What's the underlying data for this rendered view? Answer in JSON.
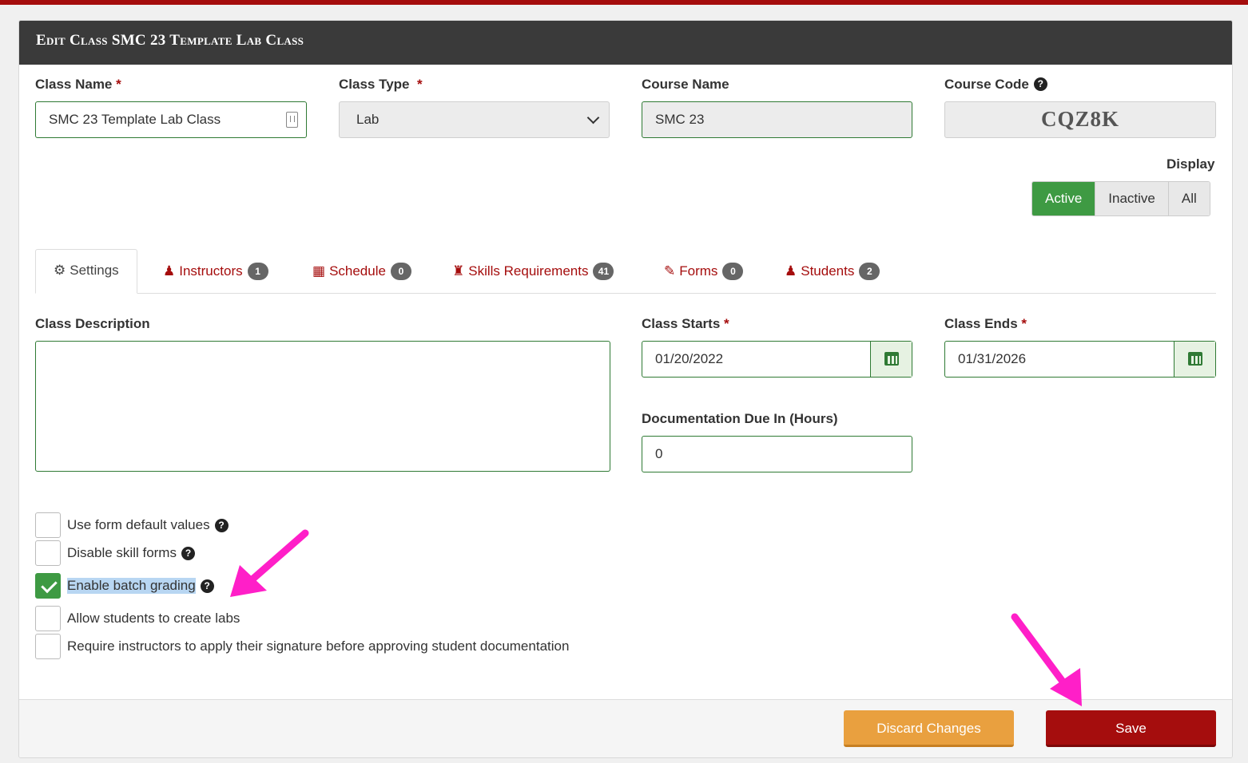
{
  "header": {
    "title": "Edit Class SMC 23 Template Lab Class"
  },
  "fields": {
    "class_name": {
      "label": "Class Name",
      "required": "*",
      "value": "SMC 23 Template Lab Class"
    },
    "class_type": {
      "label": "Class Type",
      "required": "*",
      "value": "Lab"
    },
    "course_name": {
      "label": "Course Name",
      "value": "SMC 23"
    },
    "course_code": {
      "label": "Course Code",
      "value": "CQZ8K"
    }
  },
  "display": {
    "label": "Display",
    "options": [
      "Active",
      "Inactive",
      "All"
    ],
    "selected": "Active",
    "accent_color": "#3e9a43"
  },
  "tabs": [
    {
      "label": "Settings",
      "icon": "gear-icon",
      "active": true
    },
    {
      "label": "Instructors",
      "icon": "user-icon",
      "count": "1"
    },
    {
      "label": "Schedule",
      "icon": "calendar-icon",
      "count": "0"
    },
    {
      "label": "Skills Requirements",
      "icon": "chess-rook-icon",
      "count": "41"
    },
    {
      "label": "Forms",
      "icon": "pencil-icon",
      "count": "0"
    },
    {
      "label": "Students",
      "icon": "user-icon",
      "count": "2"
    }
  ],
  "settings": {
    "description_label": "Class Description",
    "class_starts": {
      "label": "Class Starts",
      "required": "*",
      "value": "01/20/2022"
    },
    "class_ends": {
      "label": "Class Ends",
      "required": "*",
      "value": "01/31/2026"
    },
    "doc_due": {
      "label": "Documentation Due In (Hours)",
      "value": "0"
    },
    "checkboxes": [
      {
        "label": "Use form default values",
        "checked": false,
        "help": true
      },
      {
        "label": "Disable skill forms",
        "checked": false,
        "help": true
      },
      {
        "label": "Enable batch grading",
        "checked": true,
        "help": true
      },
      {
        "label": "Allow students to create labs",
        "checked": false
      },
      {
        "label": "Require instructors to apply their signature before approving student documentation",
        "checked": false
      }
    ]
  },
  "footer": {
    "discard_label": "Discard Changes",
    "save_label": "Save"
  },
  "colors": {
    "brand": "#a50d0d",
    "success": "#3e9a43",
    "warning": "#e9a03f",
    "annotation": "#ff1fc8"
  }
}
